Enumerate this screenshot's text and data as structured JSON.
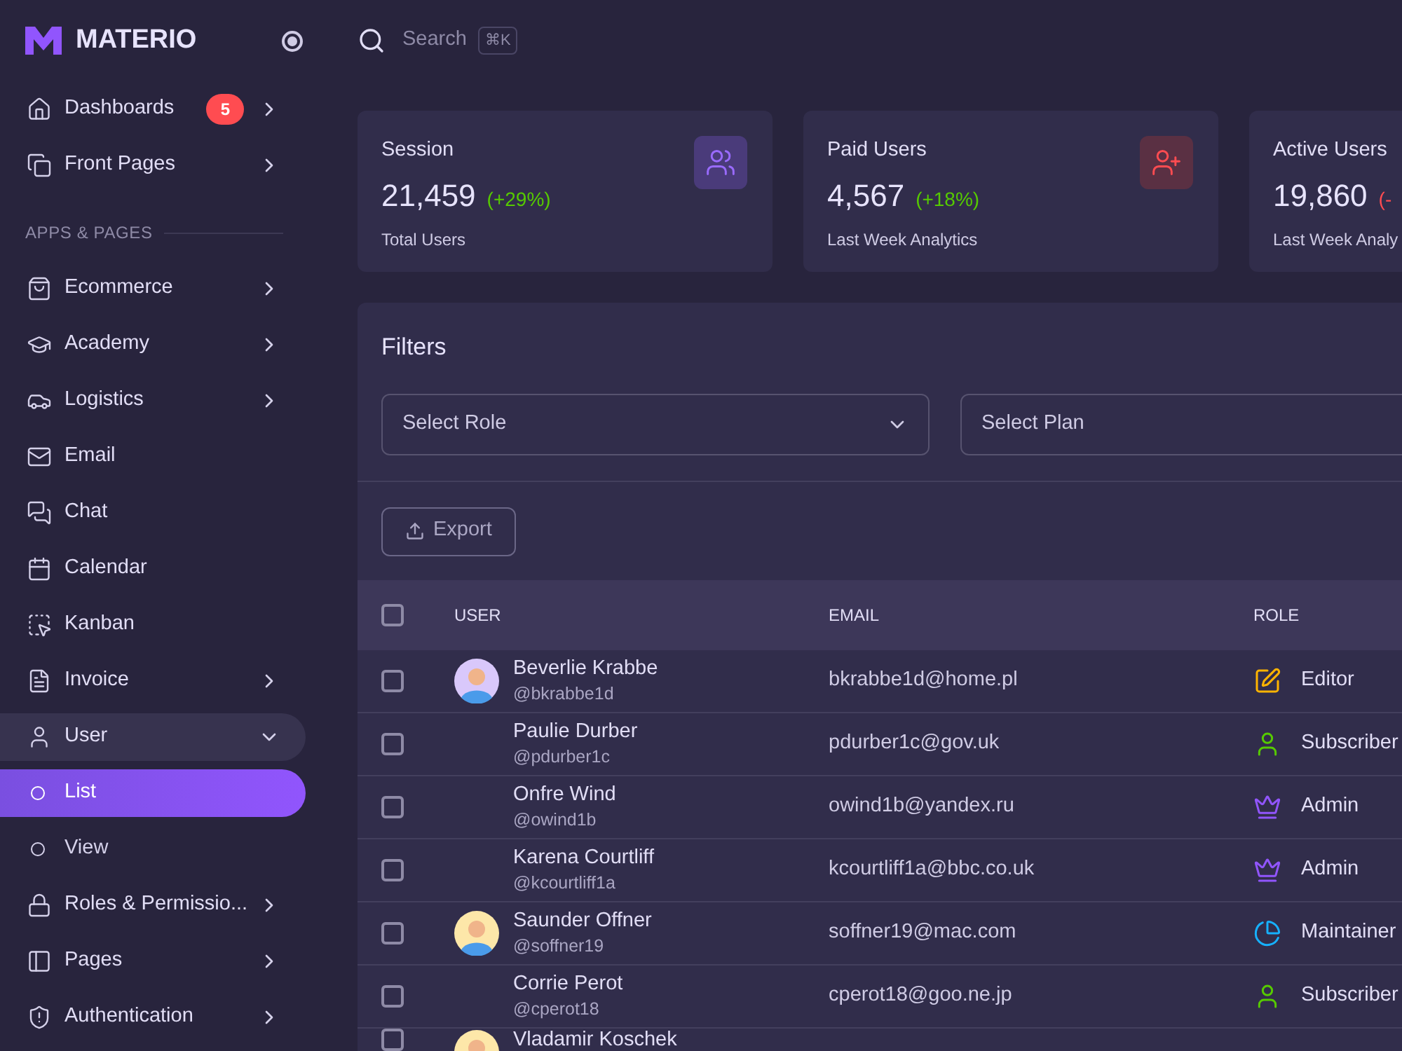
{
  "sidebar": {
    "logo": "MATERIO",
    "pinned": true,
    "top_items": [
      {
        "label": "Dashboards",
        "badge": "5",
        "chevron": true
      },
      {
        "label": "Front Pages",
        "chevron": true
      }
    ],
    "section_title": "APPS & PAGES",
    "items": [
      {
        "label": "Ecommerce",
        "chevron": true,
        "expanded": false
      },
      {
        "label": "Academy",
        "chevron": true,
        "expanded": false
      },
      {
        "label": "Logistics",
        "chevron": true,
        "expanded": false
      },
      {
        "label": "Email",
        "chevron": false,
        "expanded": false
      },
      {
        "label": "Chat",
        "chevron": false,
        "expanded": false
      },
      {
        "label": "Calendar",
        "chevron": false,
        "expanded": false
      },
      {
        "label": "Kanban",
        "chevron": false,
        "expanded": false
      },
      {
        "label": "Invoice",
        "chevron": true,
        "expanded": false
      },
      {
        "label": "User",
        "chevron": true,
        "expanded": true,
        "children": [
          {
            "label": "List",
            "selected": true
          },
          {
            "label": "View",
            "selected": false
          }
        ]
      },
      {
        "label": "Roles & Permissio...",
        "chevron": true,
        "expanded": false
      },
      {
        "label": "Pages",
        "chevron": true,
        "expanded": false
      },
      {
        "label": "Authentication",
        "chevron": true,
        "expanded": false
      }
    ]
  },
  "search": {
    "placeholder": "Search",
    "shortcut": "⌘K"
  },
  "stats": [
    {
      "title": "Session",
      "value": "21,459",
      "change": "(+29%)",
      "color": "#56ca00",
      "caption": "Total Users"
    },
    {
      "title": "Paid Users",
      "value": "4,567",
      "change": "(+18%)",
      "color": "#56ca00",
      "caption": "Last Week Analytics"
    },
    {
      "title": "Active Users",
      "value": "19,860",
      "change": "(-",
      "color": "#ff4c51",
      "caption": "Last Week Analy"
    }
  ],
  "filters": {
    "title": "Filters",
    "selects": [
      {
        "placeholder": "Select Role"
      },
      {
        "placeholder": "Select Plan"
      }
    ],
    "export": "Export"
  },
  "table": {
    "select_all": {
      "checked": false
    },
    "columns": [
      "USER",
      "EMAIL",
      "ROLE"
    ],
    "rows": [
      {
        "name": "Beverlie Krabbe",
        "handle": "@bkrabbe1d",
        "email": "bkrabbe1d@home.pl",
        "role": "Editor",
        "kind": "editor",
        "color": "#ffb400",
        "avatar": true,
        "checked": false
      },
      {
        "name": "Paulie Durber",
        "handle": "@pdurber1c",
        "email": "pdurber1c@gov.uk",
        "role": "Subscriber",
        "kind": "subscriber",
        "color": "#56ca00",
        "checked": false
      },
      {
        "name": "Onfre Wind",
        "handle": "@owind1b",
        "email": "owind1b@yandex.ru",
        "role": "Admin",
        "kind": "admin",
        "color": "#9155fd",
        "checked": false
      },
      {
        "name": "Karena Courtliff",
        "handle": "@kcourtliff1a",
        "email": "kcourtliff1a@bbc.co.uk",
        "role": "Admin",
        "kind": "admin",
        "color": "#9155fd",
        "checked": false
      },
      {
        "name": "Saunder Offner",
        "handle": "@soffner19",
        "email": "soffner19@mac.com",
        "role": "Maintainer",
        "kind": "maintainer",
        "color": "#16b1ff",
        "avatar": true,
        "checked": false
      },
      {
        "name": "Corrie Perot",
        "handle": "@cperot18",
        "email": "cperot18@goo.ne.jp",
        "role": "Subscriber",
        "kind": "subscriber",
        "color": "#56ca00",
        "checked": false
      },
      {
        "name": "Vladamir Koschek",
        "partial": true,
        "avatar": true,
        "checked": false
      }
    ]
  }
}
